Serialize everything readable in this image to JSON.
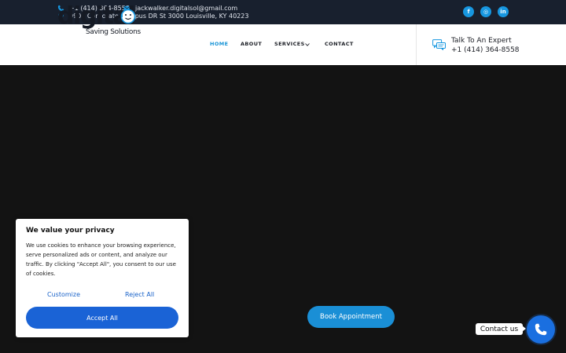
{
  "topbar": {
    "phone": "+1 (414) 364-8558",
    "email": "jackwalker.digitalsol@gmail.com",
    "address": "9900 Corporate Campus DR St 3000 Louisville, KY 40223",
    "social": [
      {
        "icon": "facebook-icon",
        "glyph": "f"
      },
      {
        "icon": "instagram-icon",
        "glyph": "◎"
      },
      {
        "icon": "linkedin-icon",
        "glyph": "in"
      }
    ]
  },
  "logo": {
    "word": "digital",
    "subtitle": "Saving Solutions"
  },
  "nav": {
    "home": "HOME",
    "about": "ABOUT",
    "services": "SERVICES",
    "contact": "CONTACT"
  },
  "expert": {
    "title": "Talk To An Expert",
    "phone": "+1 (414) 364-8558"
  },
  "hero": {
    "book_label": "Book Appointment"
  },
  "cookie": {
    "title": "We value your privacy",
    "body": "We use cookies to enhance your browsing experience, serve personalized ads or content, and analyze our traffic. By clicking \"Accept All\", you consent to our use of cookies.",
    "customize": "Customize",
    "reject": "Reject All",
    "accept": "Accept All"
  },
  "contact_widget": {
    "label": "Contact us"
  },
  "colors": {
    "accent": "#1693d6",
    "topbar_bg": "#18202e",
    "hero_bg": "#131313",
    "cookie_button": "#1a63d6"
  }
}
